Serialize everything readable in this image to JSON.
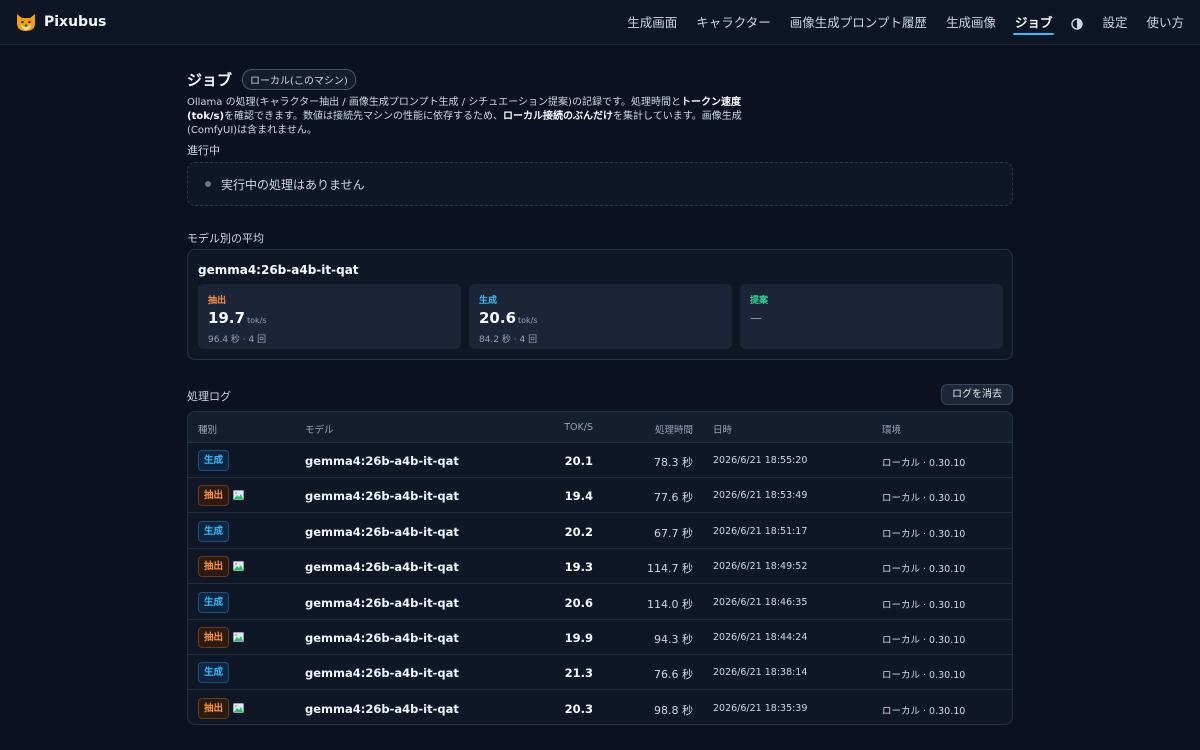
{
  "app": {
    "name": "Pixubus"
  },
  "nav": [
    {
      "label": "生成画面",
      "active": false
    },
    {
      "label": "キャラクター",
      "active": false
    },
    {
      "label": "画像生成プロンプト履歴",
      "active": false
    },
    {
      "label": "生成画像",
      "active": false
    },
    {
      "label": "ジョブ",
      "active": true
    },
    {
      "label": "設定",
      "active": false
    },
    {
      "label": "使い方",
      "active": false
    }
  ],
  "page": {
    "title": "ジョブ",
    "env_badge": "ローカル(このマシン)",
    "desc": {
      "p1": "Ollama の処理(キャラクター抽出 / 画像生成プロンプト生成 / シチュエーション提案)の記録です。処理時間と",
      "b1": "トークン速度(tok/s)",
      "p2": "を確認できます。数値は接続先マシンの性能に依存するため、",
      "b2": "ローカル接続のぶんだけ",
      "p3": "を集計しています。画像生成(ComfyUI)は含まれません。"
    }
  },
  "running": {
    "label": "進行中",
    "empty_text": "実行中の処理はありません"
  },
  "averages": {
    "label": "モデル別の平均",
    "model": "gemma4:26b-a4b-it-qat",
    "stats": [
      {
        "label": "抽出",
        "value": "19.7",
        "unit": "tok/s",
        "sub": "96.4 秒 · 4 回",
        "color": "#fb923c"
      },
      {
        "label": "生成",
        "value": "20.6",
        "unit": "tok/s",
        "sub": "84.2 秒 · 4 回",
        "color": "#38bdf8"
      },
      {
        "label": "提案",
        "value": "",
        "unit": "",
        "sub": "",
        "dash": "—",
        "color": "#34d399"
      }
    ]
  },
  "log": {
    "label": "処理ログ",
    "clear_button": "ログを消去",
    "columns": {
      "kind": "種別",
      "model": "モデル",
      "tps": "TOK/S",
      "duration": "処理時間",
      "date": "日時",
      "env": "環境"
    },
    "rows": [
      {
        "kind": "生成",
        "type": "gen",
        "image": false,
        "model": "gemma4:26b-a4b-it-qat",
        "tps": "20.1",
        "duration": "78.3 秒",
        "date": "2026/6/21 18:55:20",
        "env": "ローカル · 0.30.10"
      },
      {
        "kind": "抽出",
        "type": "ext",
        "image": true,
        "model": "gemma4:26b-a4b-it-qat",
        "tps": "19.4",
        "duration": "77.6 秒",
        "date": "2026/6/21 18:53:49",
        "env": "ローカル · 0.30.10"
      },
      {
        "kind": "生成",
        "type": "gen",
        "image": false,
        "model": "gemma4:26b-a4b-it-qat",
        "tps": "20.2",
        "duration": "67.7 秒",
        "date": "2026/6/21 18:51:17",
        "env": "ローカル · 0.30.10"
      },
      {
        "kind": "抽出",
        "type": "ext",
        "image": true,
        "model": "gemma4:26b-a4b-it-qat",
        "tps": "19.3",
        "duration": "114.7 秒",
        "date": "2026/6/21 18:49:52",
        "env": "ローカル · 0.30.10"
      },
      {
        "kind": "生成",
        "type": "gen",
        "image": false,
        "model": "gemma4:26b-a4b-it-qat",
        "tps": "20.6",
        "duration": "114.0 秒",
        "date": "2026/6/21 18:46:35",
        "env": "ローカル · 0.30.10"
      },
      {
        "kind": "抽出",
        "type": "ext",
        "image": true,
        "model": "gemma4:26b-a4b-it-qat",
        "tps": "19.9",
        "duration": "94.3 秒",
        "date": "2026/6/21 18:44:24",
        "env": "ローカル · 0.30.10"
      },
      {
        "kind": "生成",
        "type": "gen",
        "image": false,
        "model": "gemma4:26b-a4b-it-qat",
        "tps": "21.3",
        "duration": "76.6 秒",
        "date": "2026/6/21 18:38:14",
        "env": "ローカル · 0.30.10"
      },
      {
        "kind": "抽出",
        "type": "ext",
        "image": true,
        "model": "gemma4:26b-a4b-it-qat",
        "tps": "20.3",
        "duration": "98.8 秒",
        "date": "2026/6/21 18:35:39",
        "env": "ローカル · 0.30.10"
      }
    ]
  }
}
